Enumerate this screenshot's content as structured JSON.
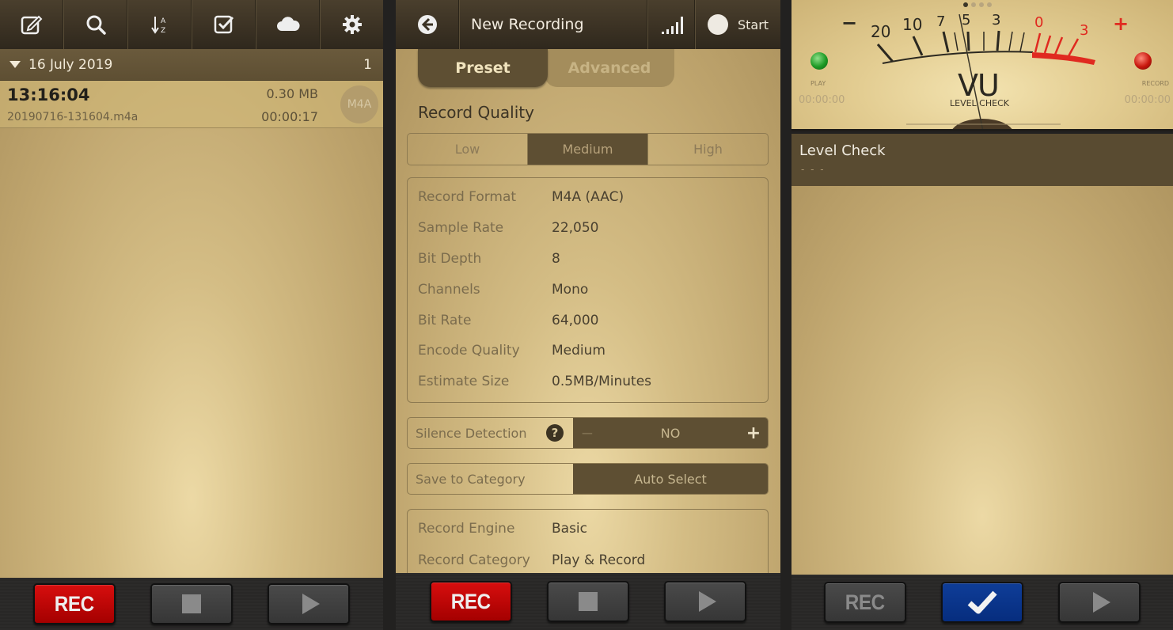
{
  "list_panel": {
    "toolbar": [
      {
        "icon": "edit-icon"
      },
      {
        "icon": "search-icon"
      },
      {
        "icon": "sort-az-icon"
      },
      {
        "icon": "select-checkbox-icon"
      },
      {
        "icon": "cloud-icon"
      },
      {
        "icon": "gear-icon"
      }
    ],
    "section": {
      "date": "16 July 2019",
      "count": "1"
    },
    "recordings": [
      {
        "time": "13:16:04",
        "filename": "20190716-131604.m4a",
        "size": "0.30 MB",
        "duration": "00:00:17",
        "format": "M4A"
      }
    ],
    "transport": {
      "rec": "REC",
      "rec_color": "#c80808"
    }
  },
  "settings_panel": {
    "title": "New Recording",
    "start_label": "Start",
    "tabs": [
      {
        "label": "Preset",
        "active": true
      },
      {
        "label": "Advanced",
        "active": false
      }
    ],
    "record_quality": {
      "title": "Record Quality",
      "options": [
        "Low",
        "Medium",
        "High"
      ],
      "selected": "Medium"
    },
    "specs": [
      {
        "key": "Record Format",
        "value": "M4A (AAC)"
      },
      {
        "key": "Sample Rate",
        "value": "22,050"
      },
      {
        "key": "Bit Depth",
        "value": "8"
      },
      {
        "key": "Channels",
        "value": "Mono"
      },
      {
        "key": "Bit Rate",
        "value": "64,000"
      },
      {
        "key": "Encode Quality",
        "value": "Medium"
      },
      {
        "key": "Estimate Size",
        "value": "0.5MB/Minutes"
      }
    ],
    "silence_detection": {
      "label": "Silence Detection",
      "help": "?",
      "value": "NO",
      "minus": "−",
      "plus": "+"
    },
    "save_to_category": {
      "label": "Save to Category",
      "value": "Auto Select"
    },
    "engine": [
      {
        "key": "Record Engine",
        "value": "Basic"
      },
      {
        "key": "Record Category",
        "value": "Play & Record"
      }
    ],
    "transport": {
      "rec": "REC"
    }
  },
  "level_panel": {
    "vu": {
      "scale_left": [
        "20",
        "10",
        "7",
        "5",
        "3"
      ],
      "scale_right": [
        "0",
        "3"
      ],
      "minus": "−",
      "plus": "+",
      "label": "VU",
      "sublabel": "LEVEL CHECK",
      "play_label": "PLAY",
      "record_label": "RECORD",
      "play_time": "00:00:00",
      "record_time": "00:00:00",
      "page_count": 4,
      "page_active": 1,
      "red_zone_color": "#e02a20"
    },
    "header": {
      "title": "Level Check",
      "subtitle": "- - -"
    },
    "transport": {
      "rec": "REC",
      "confirm_color": "#0a3a92"
    }
  }
}
